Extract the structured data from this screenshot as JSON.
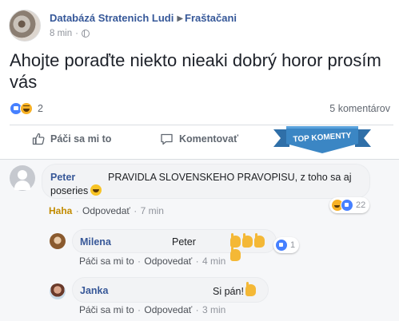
{
  "post": {
    "page_name": "Databázá Stratenich Ludi",
    "group_name": "Fraštačani",
    "time": "8 min",
    "text": "Ahojte poraďte niekto nieaki dobrý horor prosím vás",
    "reactions_count": "2",
    "comments_count": "5 komentárov"
  },
  "actions": {
    "like_label": "Páči sa mi to",
    "comment_label": "Komentovať"
  },
  "badge": {
    "label": "TOP KOMENTY"
  },
  "comments": [
    {
      "author": "Peter",
      "text": "PRAVIDLA SLOVENSKEHO PRAVOPISU, z toho sa aj",
      "text_line2": "poseries",
      "reaction_label": "Haha",
      "reply_label": "Odpovedať",
      "time": "7 min",
      "reactions_count": "22"
    },
    {
      "author": "Milena",
      "text": "Peter",
      "like_label": "Páči sa mi to",
      "reply_label": "Odpovedať",
      "time": "4 min",
      "reactions_count": "1"
    },
    {
      "author": "Janka",
      "text": "Si pán!",
      "like_label": "Páči sa mi to",
      "reply_label": "Odpovedať",
      "time": "3 min"
    }
  ],
  "colors": {
    "link_blue": "#385898",
    "like_blue": "#4680ff",
    "haha_yellow": "#f7b125",
    "badge_blue": "#3b86c4"
  },
  "icons": [
    "globe-icon",
    "like-reaction-icon",
    "haha-reaction-icon",
    "thumbs-up-icon",
    "comment-bubble-icon",
    "laugh-emoji-icon",
    "pointing-hand-emoji-icon",
    "user-placeholder-icon"
  ]
}
